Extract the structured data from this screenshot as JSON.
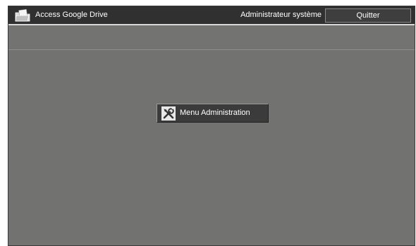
{
  "app": {
    "title": "Access Google Drive",
    "icon": "folder-document-icon"
  },
  "header": {
    "user": "Administrateur système",
    "quit_label": "Quitter"
  },
  "main": {
    "admin_button": {
      "label": "Menu Administration",
      "icon": "tools-icon"
    }
  },
  "colors": {
    "titlebar": "#2f302f",
    "background": "#727371",
    "button": "#3a3b3a"
  }
}
